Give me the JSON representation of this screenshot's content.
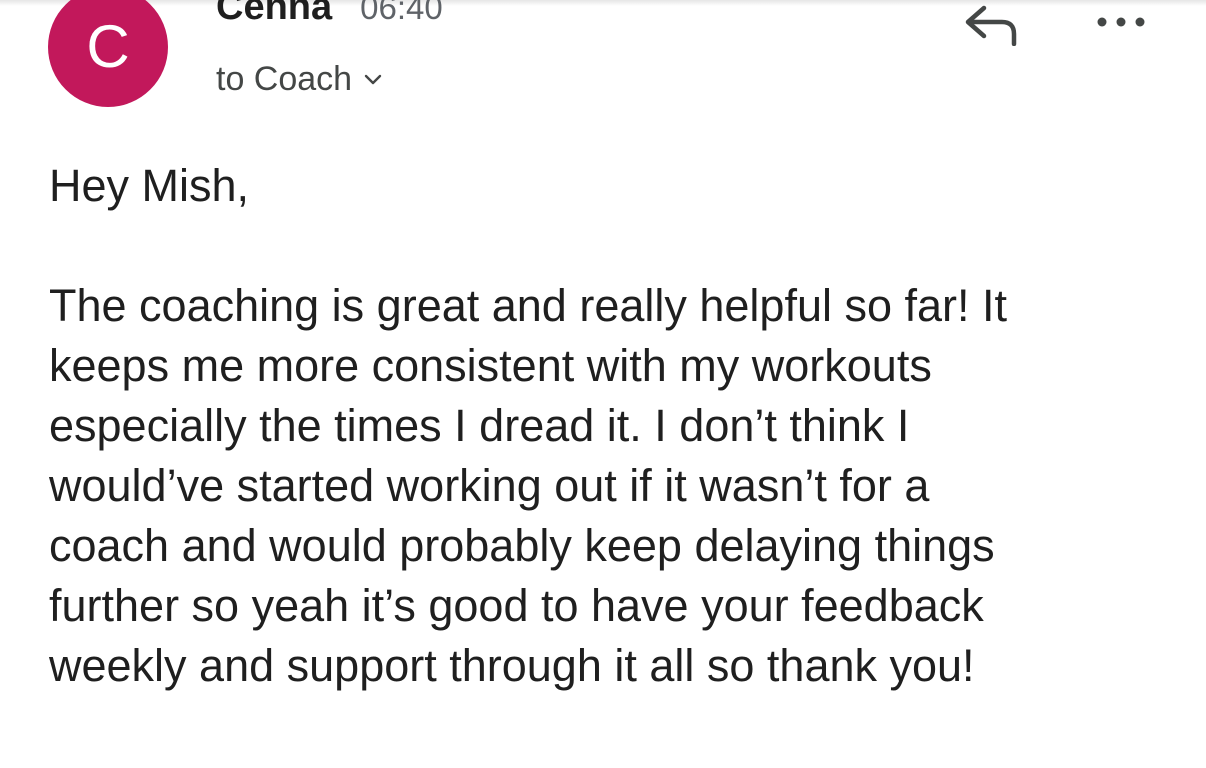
{
  "header": {
    "avatar_letter": "C",
    "avatar_color": "#c2185b",
    "sender": "Cenna",
    "time": "06:40",
    "recipient": "to Coach",
    "reply_icon": "reply-icon",
    "more_icon": "more-options-icon"
  },
  "message": {
    "greeting": "Hey Mish,",
    "paragraph_1": "The coaching is great and really helpful so far! It\nkeeps me more consistent with my workouts\nespecially the times I dread it. I don’t think I\nwould’ve started working out if it wasn’t for a\ncoach and would probably keep delaying things\nfurther so yeah it’s good to have your feedback\nweekly and support through it all so thank you!"
  }
}
